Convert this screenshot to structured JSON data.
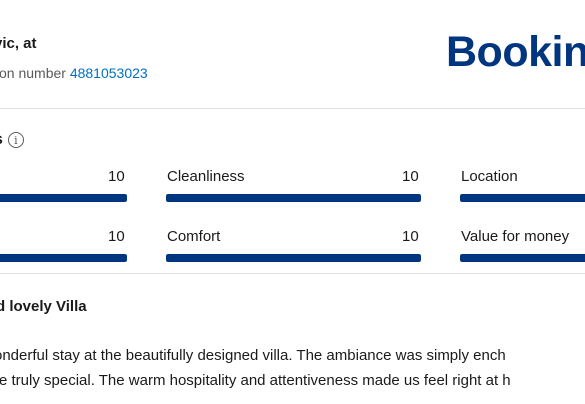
{
  "header": {
    "guest_name": "vic, at",
    "reservation_label": "tion number",
    "reservation_number": "4881053023",
    "brand_logo": "Bookin",
    "brand_color": "#003580"
  },
  "scores": {
    "heading": "s",
    "info_icon": "info-icon",
    "bar_color": "#003580",
    "categories": [
      {
        "label": "",
        "score": "10",
        "fraction": 1.0
      },
      {
        "label": "Cleanliness",
        "score": "10",
        "fraction": 1.0
      },
      {
        "label": "Location",
        "score": "",
        "fraction": 1.0
      },
      {
        "label": "",
        "score": "10",
        "fraction": 1.0
      },
      {
        "label": "Comfort",
        "score": "10",
        "fraction": 1.0
      },
      {
        "label": "Value for money",
        "score": "",
        "fraction": 1.0
      }
    ]
  },
  "review": {
    "title": "d lovely Villa",
    "lines": [
      "onderful stay at the beautifully designed villa. The ambiance was simply ench",
      "re truly special. The warm hospitality and attentiveness made us feel right at h"
    ]
  }
}
